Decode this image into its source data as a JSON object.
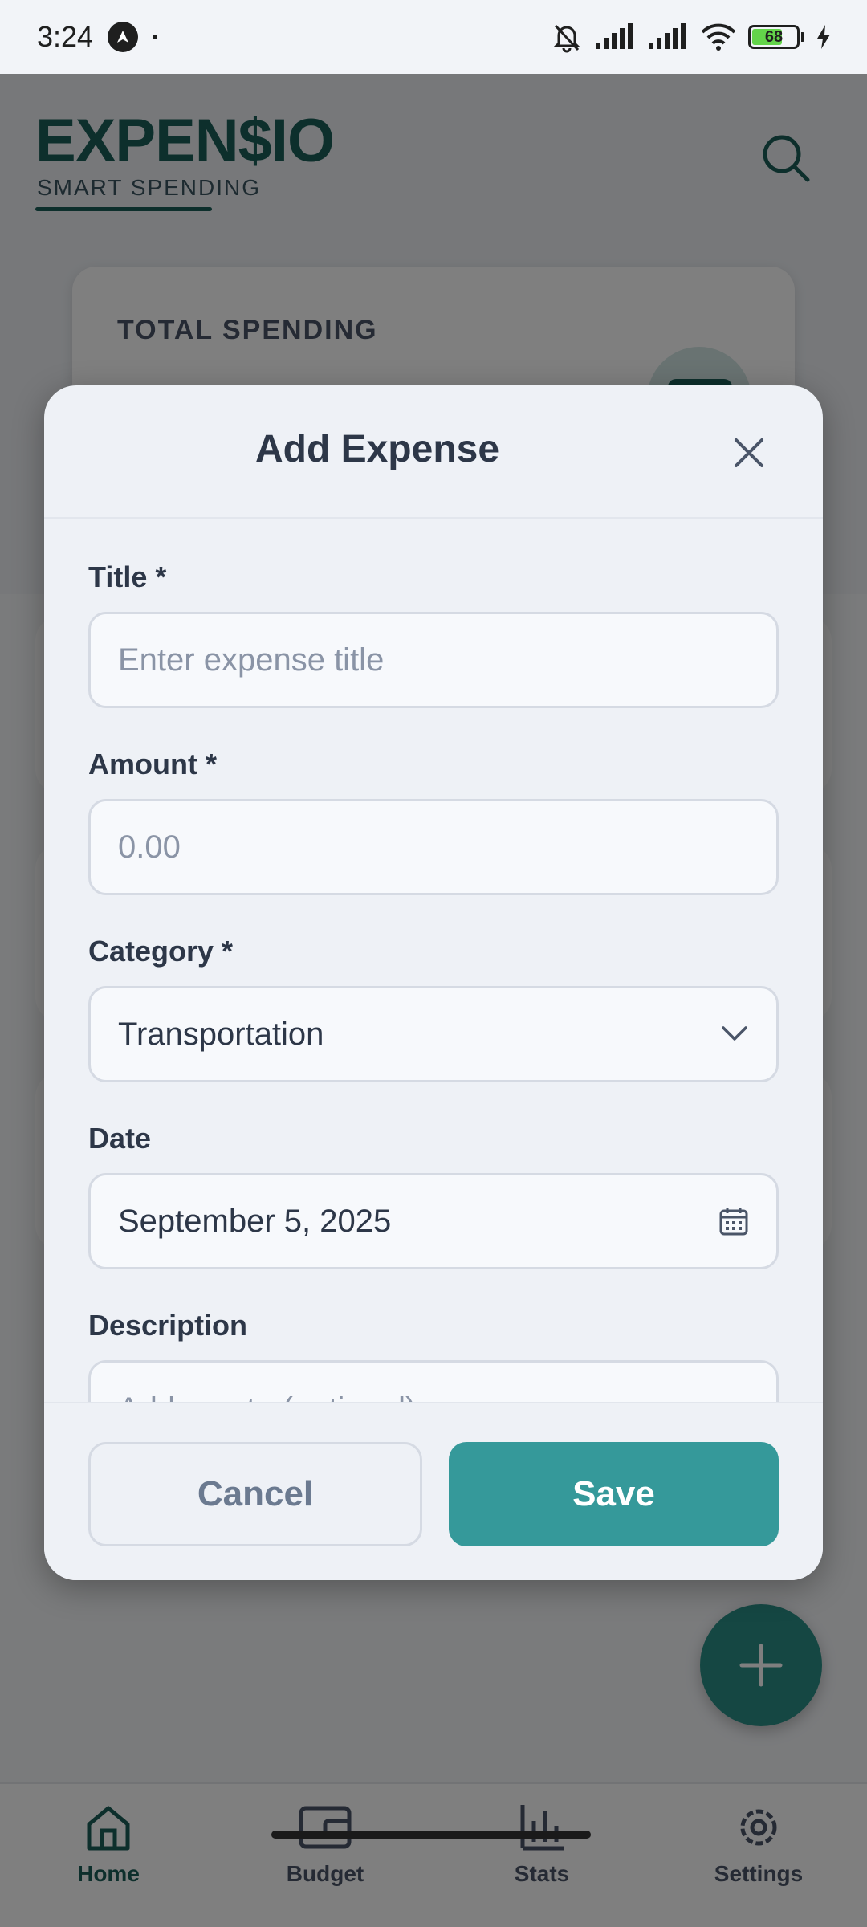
{
  "status_bar": {
    "time": "3:24",
    "battery": "68"
  },
  "app": {
    "logo_title": "EXPEN$IO",
    "logo_subtitle": "SMART SPENDING",
    "total_label": "TOTAL SPENDING"
  },
  "bottom_nav": {
    "items": [
      {
        "label": "Home",
        "icon": "home-icon",
        "active": true
      },
      {
        "label": "Budget",
        "icon": "wallet-icon",
        "active": false
      },
      {
        "label": "Stats",
        "icon": "bar-chart-icon",
        "active": false
      },
      {
        "label": "Settings",
        "icon": "gear-icon",
        "active": false
      }
    ]
  },
  "modal": {
    "title": "Add Expense",
    "fields": {
      "title_label": "Title *",
      "title_placeholder": "Enter expense title",
      "amount_label": "Amount *",
      "amount_placeholder": "0.00",
      "category_label": "Category *",
      "category_value": "Transportation",
      "date_label": "Date",
      "date_value": "September 5, 2025",
      "description_label": "Description",
      "description_placeholder": "Add a note (optional)"
    },
    "cancel_label": "Cancel",
    "save_label": "Save"
  },
  "colors": {
    "brand": "#1b5e58",
    "save_button": "#35999a",
    "modal_background": "#eef1f6"
  }
}
